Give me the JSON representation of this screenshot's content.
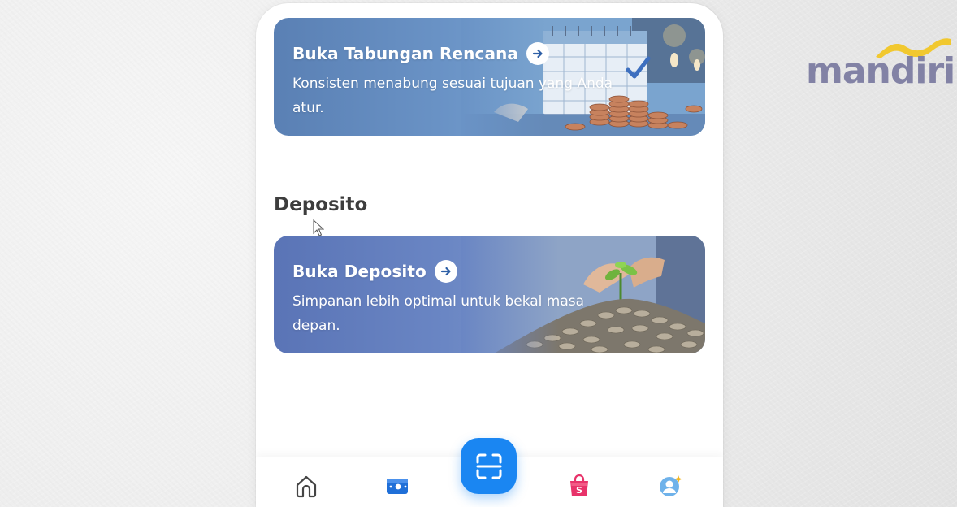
{
  "brand": {
    "name": "mandiri",
    "wave_color": "#f2c61f",
    "text_color": "#7a7aa0"
  },
  "cards": [
    {
      "title": "Buka Tabungan Rencana",
      "description": "Konsisten menabung sesuai tujuan yang Anda atur.",
      "arrow_icon": "arrow-right-icon",
      "illustration": "calendar-coins-illustration"
    },
    {
      "title": "Buka Deposito",
      "description": "Simpanan lebih optimal untuk bekal masa depan.",
      "arrow_icon": "arrow-right-icon",
      "illustration": "coins-plant-illustration"
    }
  ],
  "section": {
    "deposito_title": "Deposito"
  },
  "bottom_nav": {
    "items": [
      {
        "icon": "home-icon",
        "label": ""
      },
      {
        "icon": "wallet-icon",
        "label": "",
        "active": true
      },
      {
        "icon": "qris-scan-icon",
        "label": ""
      },
      {
        "icon": "shopping-bag-icon",
        "label": ""
      },
      {
        "icon": "profile-icon",
        "label": ""
      }
    ]
  },
  "colors": {
    "accent": "#1a86f2",
    "active_nav": "#1f6fd8",
    "shop_bag": "#e8336a"
  }
}
